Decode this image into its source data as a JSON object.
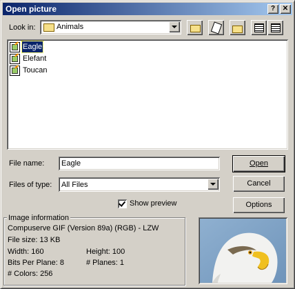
{
  "window": {
    "title": "Open picture",
    "help_label": "?",
    "close_label": "✕"
  },
  "toolbar": {
    "look_in_label": "Look in:",
    "look_in_value": "Animals",
    "icons": [
      "up-folder-icon",
      "desktop-icon",
      "new-folder-icon",
      "list-view-icon",
      "details-view-icon"
    ]
  },
  "files": [
    {
      "name": "Eagle",
      "selected": true
    },
    {
      "name": "Elefant",
      "selected": false
    },
    {
      "name": "Toucan",
      "selected": false
    }
  ],
  "file_name": {
    "label": "File name:",
    "value": "Eagle"
  },
  "file_type": {
    "label": "Files of type:",
    "value": "All Files"
  },
  "buttons": {
    "open": "Open",
    "cancel": "Cancel",
    "options": "Options"
  },
  "show_preview": {
    "label": "Show preview",
    "checked": true
  },
  "image_info": {
    "title": "Image information",
    "format": "Compuserve GIF (Version 89a) (RGB) - LZW",
    "file_size": "File size: 13 KB",
    "width": "Width: 160",
    "height": "Height: 100",
    "bits_per_plane": "Bits Per Plane: 8",
    "planes": "# Planes: 1",
    "colors": "# Colors:  256"
  },
  "colors": {
    "title_start": "#0a246a",
    "title_end": "#a6caf0",
    "face": "#d4d0c8",
    "selection": "#0a246a"
  }
}
